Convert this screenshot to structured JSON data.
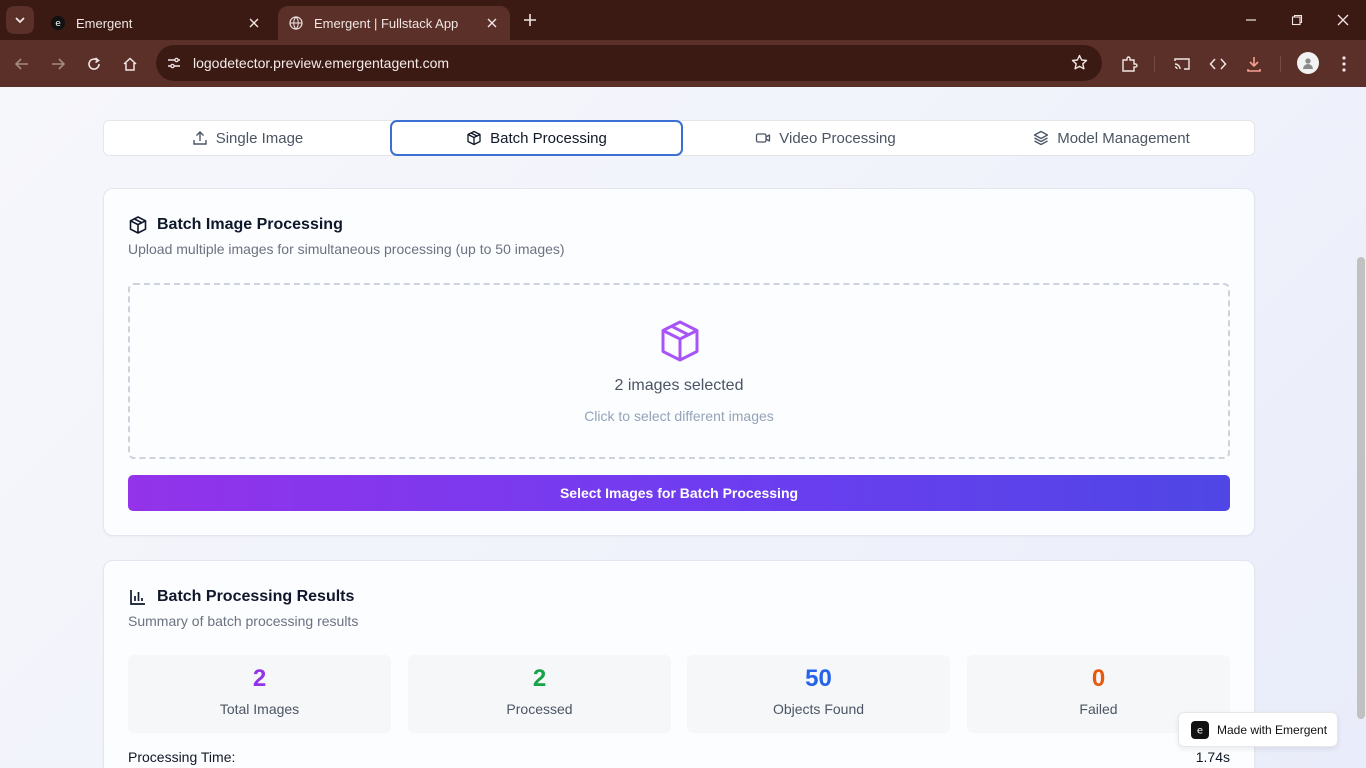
{
  "browser": {
    "tabs": [
      {
        "title": "Emergent",
        "active": false
      },
      {
        "title": "Emergent | Fullstack App",
        "active": true
      }
    ],
    "url": "logodetector.preview.emergentagent.com"
  },
  "nav_tabs": [
    {
      "label": "Single Image",
      "icon": "upload-icon",
      "active": false
    },
    {
      "label": "Batch Processing",
      "icon": "package-icon",
      "active": true
    },
    {
      "label": "Video Processing",
      "icon": "video-icon",
      "active": false
    },
    {
      "label": "Model Management",
      "icon": "layers-icon",
      "active": false
    }
  ],
  "batch_card": {
    "title": "Batch Image Processing",
    "subtitle": "Upload multiple images for simultaneous processing (up to 50 images)",
    "dropzone": {
      "main_text": "2 images selected",
      "sub_text": "Click to select different images"
    },
    "button_label": "Select Images for Batch Processing"
  },
  "results_card": {
    "title": "Batch Processing Results",
    "subtitle": "Summary of batch processing results",
    "stats": [
      {
        "value": "2",
        "label": "Total Images",
        "color": "#9333ea"
      },
      {
        "value": "2",
        "label": "Processed",
        "color": "#16a34a"
      },
      {
        "value": "50",
        "label": "Objects Found",
        "color": "#2563eb"
      },
      {
        "value": "0",
        "label": "Failed",
        "color": "#ea580c"
      }
    ],
    "processing_time_label": "Processing Time:",
    "processing_time_value": "1.74s"
  },
  "badge": {
    "label": "Made with Emergent"
  },
  "colors": {
    "accent": "#3b6fd1",
    "primary_start": "#9333ea",
    "primary_end": "#4f46e5",
    "chrome": "#3b1a14"
  }
}
